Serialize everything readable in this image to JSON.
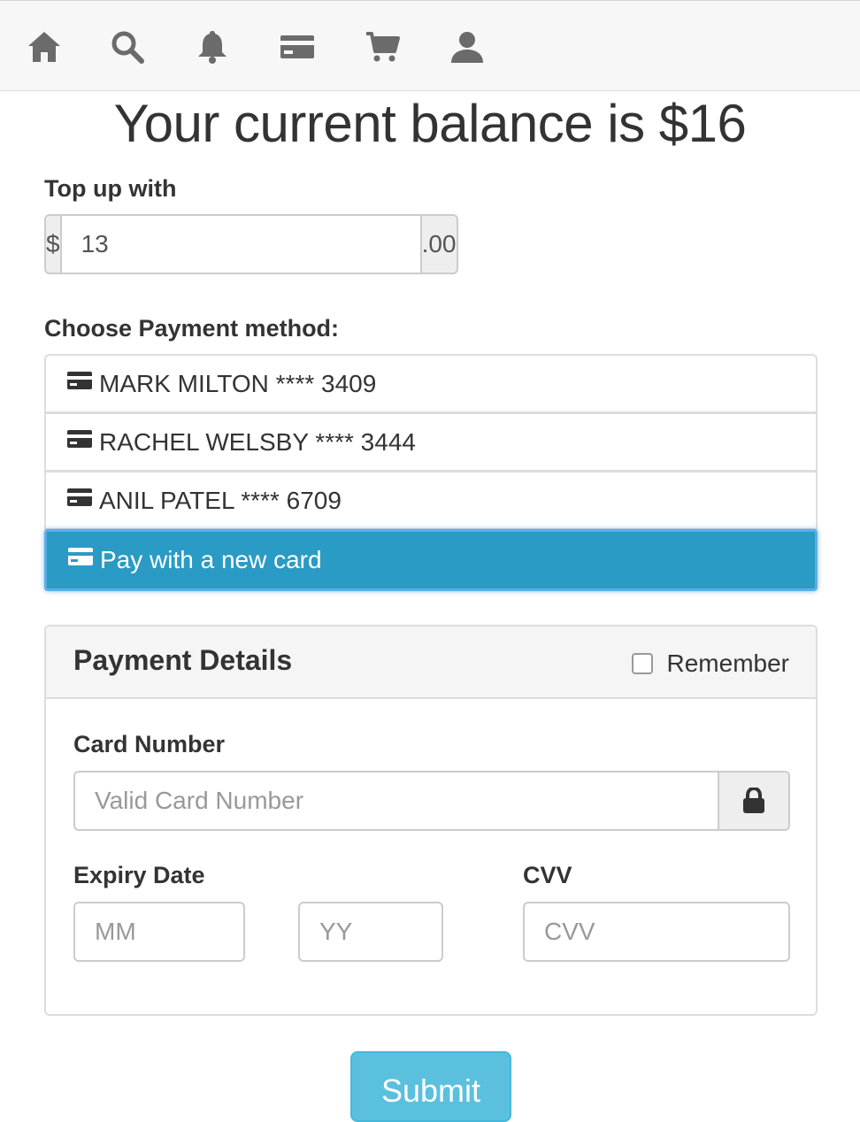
{
  "nav": {
    "icons": [
      "home-icon",
      "search-icon",
      "bell-icon",
      "credit-card-icon",
      "cart-icon",
      "user-icon"
    ]
  },
  "balance_text": "Your current balance is $16",
  "topup": {
    "label": "Top up with",
    "prefix": "$",
    "value": "13",
    "suffix": ".00"
  },
  "payment": {
    "label": "Choose Payment method:",
    "methods": [
      {
        "label": "MARK MILTON **** 3409",
        "active": false
      },
      {
        "label": "RACHEL WELSBY **** 3444",
        "active": false
      },
      {
        "label": "ANIL PATEL **** 6709",
        "active": false
      },
      {
        "label": "Pay with a new card",
        "active": true
      }
    ]
  },
  "details": {
    "title": "Payment Details",
    "remember_label": "Remember",
    "remember_checked": false,
    "card_number_label": "Card Number",
    "card_number_placeholder": "Valid Card Number",
    "expiry_label": "Expiry Date",
    "mm_placeholder": "MM",
    "yy_placeholder": "YY",
    "cvv_label": "CVV",
    "cvv_placeholder": "CVV"
  },
  "submit_label": "Submit",
  "colors": {
    "active_item": "#2a9bc4",
    "submit": "#5bc0de"
  }
}
